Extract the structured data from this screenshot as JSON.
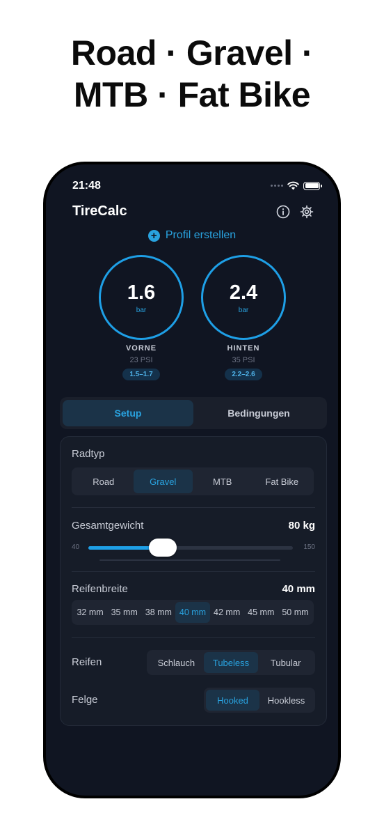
{
  "headline": {
    "line1": "Road · Gravel ·",
    "line2": "MTB · Fat Bike"
  },
  "status": {
    "time": "21:48"
  },
  "app": {
    "title": "TireCalc",
    "profile_link": "Profil erstellen"
  },
  "gauges": {
    "front": {
      "value": "1.6",
      "unit": "bar",
      "label": "VORNE",
      "psi": "23 PSI",
      "range": "1.5–1.7"
    },
    "rear": {
      "value": "2.4",
      "unit": "bar",
      "label": "HINTEN",
      "psi": "35 PSI",
      "range": "2.2–2.6"
    }
  },
  "tabs": {
    "items": [
      "Setup",
      "Bedingungen"
    ],
    "active": 0
  },
  "radtyp": {
    "label": "Radtyp",
    "options": [
      "Road",
      "Gravel",
      "MTB",
      "Fat Bike"
    ],
    "selected": 1
  },
  "weight": {
    "label": "Gesamtgewicht",
    "value_text": "80 kg",
    "min": "40",
    "max": "150",
    "value": 80,
    "range": [
      40,
      150
    ]
  },
  "width": {
    "label": "Reifenbreite",
    "value_text": "40 mm",
    "options": [
      "32 mm",
      "35 mm",
      "38 mm",
      "40 mm",
      "42 mm",
      "45 mm",
      "50 mm"
    ],
    "selected": 3
  },
  "reifen": {
    "label": "Reifen",
    "options": [
      "Schlauch",
      "Tubeless",
      "Tubular"
    ],
    "selected": 1
  },
  "felge": {
    "label": "Felge",
    "options": [
      "Hooked",
      "Hookless"
    ],
    "selected": 0
  },
  "colors": {
    "accent": "#1e9fe6",
    "background": "#101522",
    "card": "#161c28",
    "active_segment": "#1b3348"
  },
  "icons": {
    "info": "info-icon",
    "settings": "gear-icon",
    "wifi": "wifi-icon",
    "battery": "battery-icon",
    "add": "plus-circle-icon"
  }
}
